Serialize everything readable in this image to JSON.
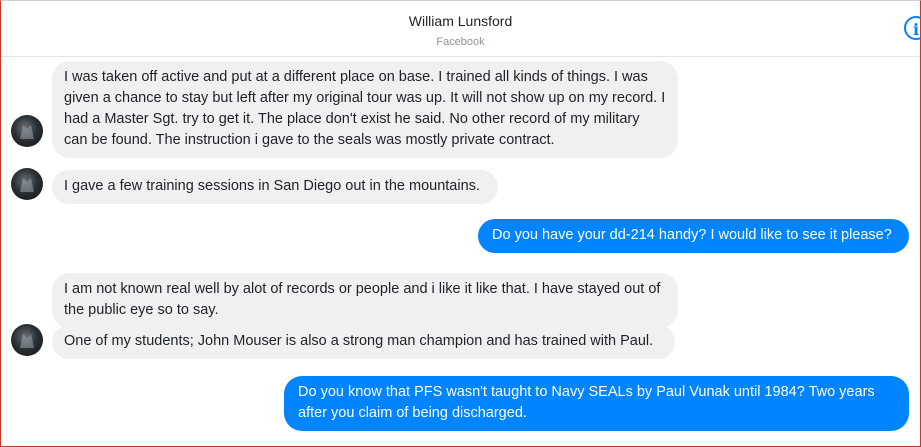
{
  "header": {
    "contact_name": "William Lunsford",
    "platform": "Facebook",
    "info_icon": "info-icon"
  },
  "messages": [
    {
      "sender": "contact",
      "text": "I was taken off active and put at a different place on base. I trained all kinds of things. I was given a chance to stay but left after my original tour was up. It will not show up on my record. I had a Master Sgt. try to get it. The place don't exist he said. No other record of my military can be found. The instruction i gave to the seals was mostly private contract."
    },
    {
      "sender": "contact",
      "text": "I gave a few training sessions in San Diego out in the mountains."
    },
    {
      "sender": "me",
      "text": "Do you have your dd-214 handy? I would like to see it please?"
    },
    {
      "sender": "contact",
      "text": "I am not known real well by alot of records or people and i like it like that. I have stayed out of the public eye so to say."
    },
    {
      "sender": "contact",
      "text": "One of my students; John Mouser is also a strong man champion and has trained with Paul."
    },
    {
      "sender": "me",
      "text": "Do you know that PFS wasn't taught to Navy SEALs by Paul Vunak until 1984? Two years after you claim of being discharged."
    }
  ],
  "colors": {
    "outgoing_bubble": "#0084ff",
    "incoming_bubble": "#f1f0f0",
    "accent": "#0084ff"
  }
}
